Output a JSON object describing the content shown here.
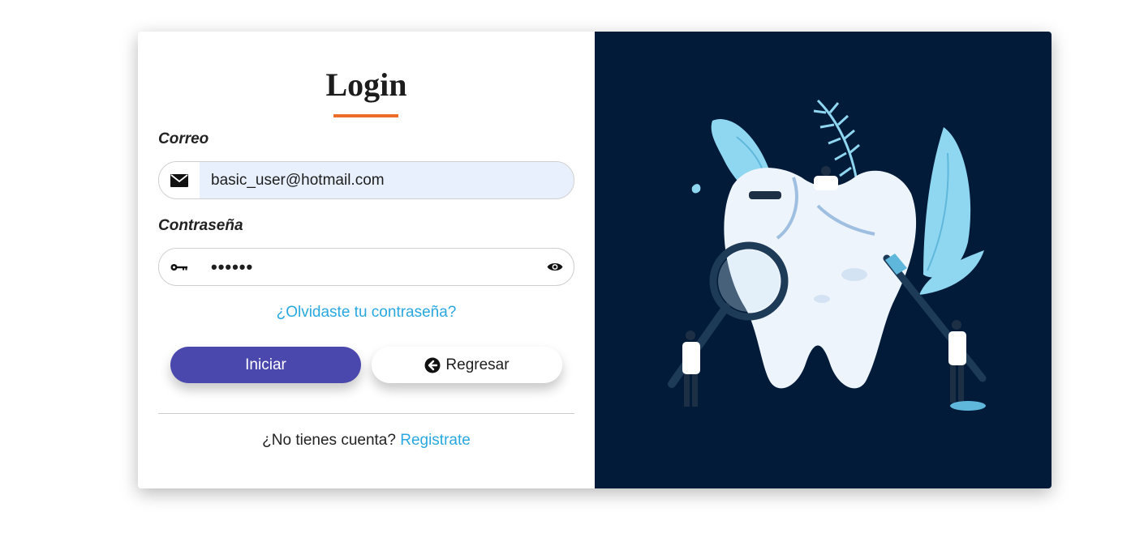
{
  "login": {
    "title": "Login",
    "email_label": "Correo",
    "email_value": "basic_user@hotmail.com",
    "password_label": "Contraseña",
    "password_value": "••••••",
    "forgot_link": "¿Olvidaste tu contraseña?",
    "submit_label": "Iniciar",
    "back_label": "Regresar",
    "no_account_text": "¿No tienes cuenta?",
    "register_link": "Registrate"
  },
  "colors": {
    "accent": "#ee6c2a",
    "primary_button": "#4b48ad",
    "link": "#29a8e0",
    "panel_background": "#011b39",
    "email_autofill": "#e8f0fe"
  },
  "icons": {
    "email": "envelope-icon",
    "password": "key-icon",
    "visibility": "eye-icon",
    "back": "arrow-left-circle-icon"
  }
}
